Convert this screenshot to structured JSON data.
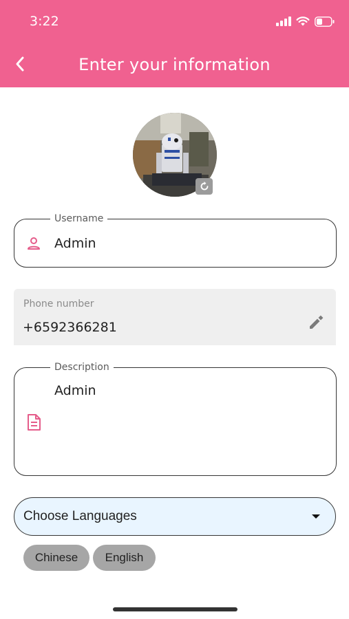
{
  "status_bar": {
    "time": "3:22"
  },
  "header": {
    "title": "Enter your information"
  },
  "avatar": {
    "description_icon": "camera-rotate-icon"
  },
  "form": {
    "username": {
      "label": "Username",
      "value": "Admin"
    },
    "phone": {
      "label": "Phone number",
      "value": "+6592366281"
    },
    "description": {
      "label": "Description",
      "value": "Admin"
    },
    "languages": {
      "placeholder": "Choose Languages",
      "selected": [
        "Chinese",
        "English"
      ]
    }
  },
  "colors": {
    "primary": "#f06190",
    "select_background": "#e9f5ff",
    "chip_background": "#a6a6a6",
    "disabled_field_background": "#efefef"
  }
}
